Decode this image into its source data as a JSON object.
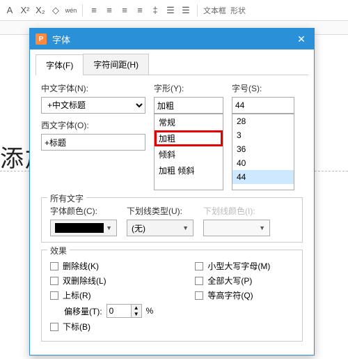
{
  "toolbar": {
    "textbox_label": "文本框",
    "shape_label": "形状"
  },
  "background_text": "添加",
  "dialog": {
    "title": "字体",
    "tabs": {
      "font": "字体(F)",
      "spacing": "字符间距(H)"
    },
    "labels": {
      "cn_font": "中文字体(N):",
      "west_font": "西文字体(O):",
      "style": "字形(Y):",
      "size": "字号(S):"
    },
    "cn_font_value": "+中文标题",
    "west_font_value": "+标题",
    "style_value": "加粗",
    "size_value": "44",
    "style_options": {
      "o0": "常规",
      "o1": "加粗",
      "o2": "倾斜",
      "o3": "加粗 倾斜"
    },
    "size_options": {
      "o0": "28",
      "o1": "3",
      "o2": "36",
      "o3": "40",
      "o4": "44"
    },
    "all_text": {
      "legend": "所有文字",
      "font_color": "字体颜色(C):",
      "underline_type": "下划线类型(U):",
      "underline_type_value": "(无)",
      "underline_color": "下划线颜色(I):"
    },
    "effects": {
      "legend": "效果",
      "strike": "删除线(K)",
      "dstrike": "双删除线(L)",
      "super": "上标(R)",
      "offset_label": "偏移量(T):",
      "offset_value": "0",
      "offset_unit": "%",
      "sub": "下标(B)",
      "smallcaps": "小型大写字母(M)",
      "allcaps": "全部大写(P)",
      "equal": "等高字符(Q)"
    }
  }
}
